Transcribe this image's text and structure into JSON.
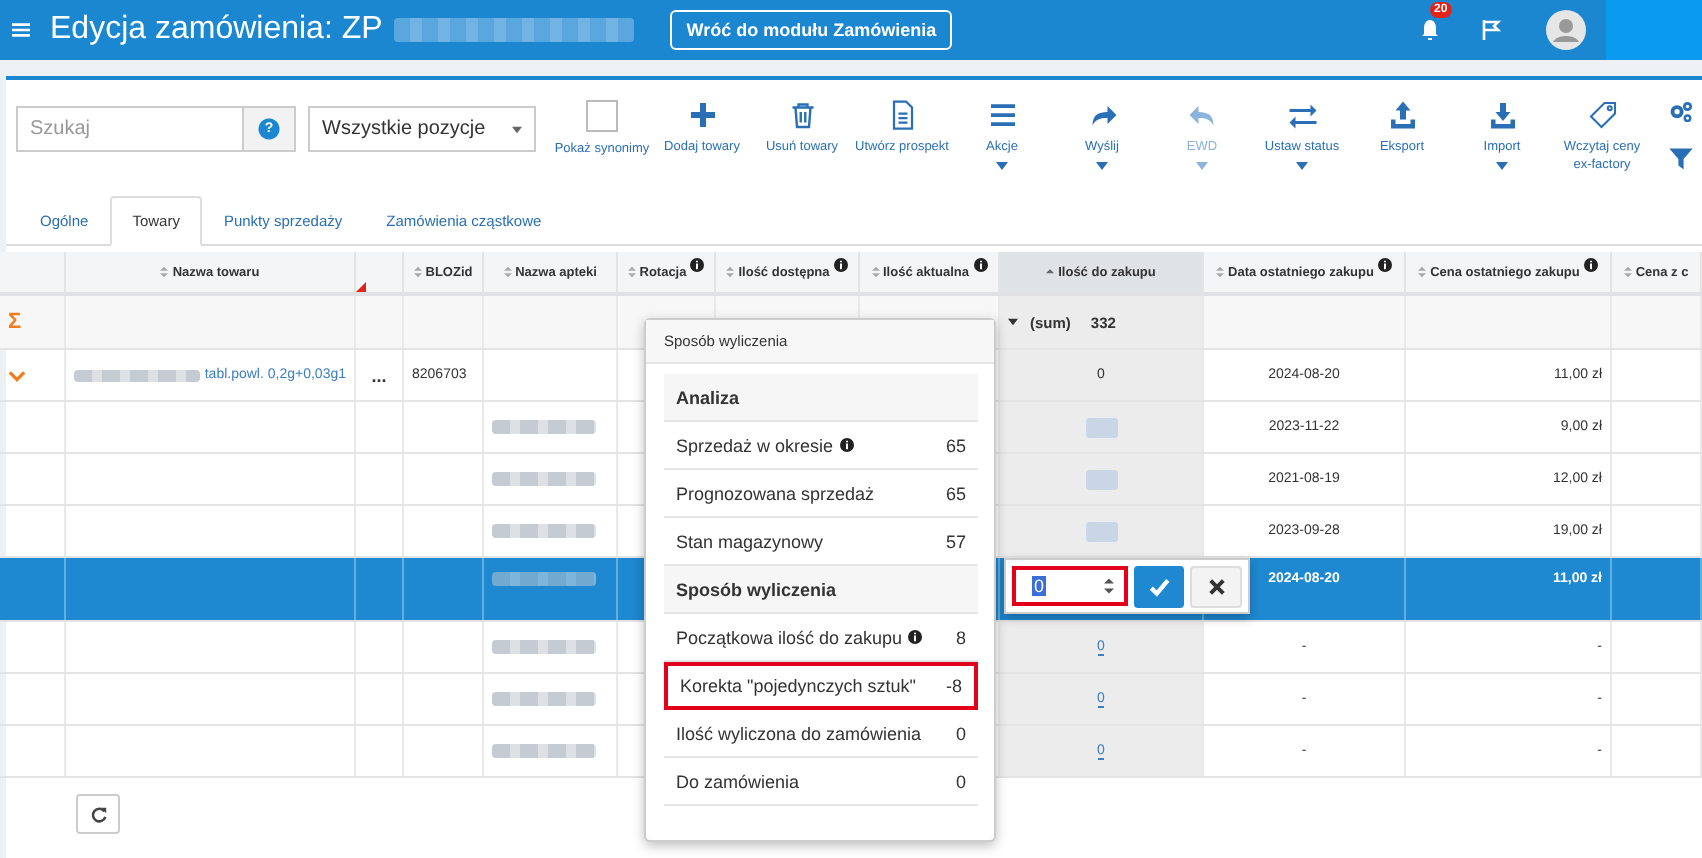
{
  "header": {
    "title": "Edycja zamówienia: ZP",
    "back_button": "Wróć do modułu Zamówienia",
    "notifications": "20"
  },
  "toolbar": {
    "search": {
      "placeholder": "Szukaj"
    },
    "help": "?",
    "filter_select": "Wszystkie pozycje",
    "synonyms": {
      "label": "Pokaż synonimy",
      "checked": false
    },
    "buttons": [
      {
        "kind": "add",
        "label": "Dodaj towary",
        "dropdown": false,
        "disabled": false
      },
      {
        "kind": "delete",
        "label": "Usuń towary",
        "dropdown": false,
        "disabled": false
      },
      {
        "kind": "document",
        "label": "Utwórz prospekt",
        "dropdown": false,
        "disabled": false
      },
      {
        "kind": "menu",
        "label": "Akcje",
        "dropdown": true,
        "disabled": false
      },
      {
        "kind": "share",
        "label": "Wyślij",
        "dropdown": true,
        "disabled": false
      },
      {
        "kind": "undo",
        "label": "EWD",
        "dropdown": true,
        "disabled": true
      },
      {
        "kind": "swap",
        "label": "Ustaw status",
        "dropdown": true,
        "disabled": false
      },
      {
        "kind": "upload",
        "label": "Eksport",
        "dropdown": false,
        "disabled": false
      },
      {
        "kind": "download",
        "label": "Import",
        "dropdown": true,
        "disabled": false
      },
      {
        "kind": "tag",
        "label": "Wczytaj ceny ex-factory",
        "dropdown": false,
        "disabled": false
      }
    ]
  },
  "tabs": [
    {
      "label": "Ogólne",
      "selected": false
    },
    {
      "label": "Towary",
      "selected": true
    },
    {
      "label": "Punkty sprzedaży",
      "selected": false
    },
    {
      "label": "Zamówienia cząstkowe",
      "selected": false
    }
  ],
  "table": {
    "columns": [
      {
        "label": "Nazwa towaru",
        "info": false,
        "sorted": false
      },
      {
        "label": "BLOZid",
        "info": false,
        "sorted": false
      },
      {
        "label": "Nazwa apteki",
        "info": false,
        "sorted": false
      },
      {
        "label": "Rotacja",
        "info": true,
        "sorted": false
      },
      {
        "label": "Ilość dostępna",
        "info": true,
        "sorted": false
      },
      {
        "label": "Ilość aktualna",
        "info": true,
        "sorted": false
      },
      {
        "label": "Ilość do zakupu",
        "info": false,
        "sorted": true
      },
      {
        "label": "Data ostatniego zakupu",
        "info": true,
        "sorted": false
      },
      {
        "label": "Cena ostatniego zakupu",
        "info": true,
        "sorted": false
      },
      {
        "label": "Cena z c",
        "info": false,
        "sorted": false
      }
    ],
    "sum_row": {
      "icon": "Σ",
      "label": "(sum)",
      "value": "332"
    },
    "rows": [
      {
        "kind": "product",
        "selected": false,
        "name": "tabl.powl. 0,2g+0,03g1",
        "menu": "...",
        "bloz": "8206703",
        "qty": "0",
        "date": "2024-08-20",
        "price": "11,00 zł"
      },
      {
        "kind": "pharmacy",
        "selected": false,
        "date": "2023-11-22",
        "price": "9,00 zł"
      },
      {
        "kind": "pharmacy",
        "selected": false,
        "date": "2021-08-19",
        "price": "12,00 zł"
      },
      {
        "kind": "pharmacy",
        "selected": false,
        "date": "2023-09-28",
        "price": "19,00 zł"
      },
      {
        "kind": "pharmacy",
        "selected": true,
        "date": "2024-08-20",
        "price": "11,00 zł"
      },
      {
        "kind": "pharmacy",
        "selected": false,
        "qty": "0",
        "date": "-",
        "price": "-"
      },
      {
        "kind": "pharmacy",
        "selected": false,
        "qty": "0",
        "date": "-",
        "price": "-"
      },
      {
        "kind": "pharmacy",
        "selected": false,
        "qty": "0",
        "date": "-",
        "price": "-"
      }
    ]
  },
  "calc_popup": {
    "title": "Sposób wyliczenia",
    "items": [
      {
        "kind": "heading",
        "label": "Analiza",
        "info": false,
        "highlighted": false
      },
      {
        "kind": "row",
        "label": "Sprzedaż w okresie",
        "value": "65",
        "info": true,
        "highlighted": false
      },
      {
        "kind": "row",
        "label": "Prognozowana sprzedaż",
        "value": "65",
        "info": false,
        "highlighted": false
      },
      {
        "kind": "row",
        "label": "Stan magazynowy",
        "value": "57",
        "info": false,
        "highlighted": false
      },
      {
        "kind": "heading",
        "label": "Sposób wyliczenia",
        "info": false,
        "highlighted": false
      },
      {
        "kind": "row",
        "label": "Początkowa ilość do zakupu",
        "value": "8",
        "info": true,
        "highlighted": false
      },
      {
        "kind": "row",
        "label": "Korekta \"pojedynczych sztuk\"",
        "value": "-8",
        "info": false,
        "highlighted": true
      },
      {
        "kind": "row",
        "label": "Ilość wyliczona do zamówienia",
        "value": "0",
        "info": false,
        "highlighted": false
      },
      {
        "kind": "row",
        "label": "Do zamówienia",
        "value": "0",
        "info": false,
        "highlighted": false
      }
    ]
  },
  "editor": {
    "value": "0"
  }
}
